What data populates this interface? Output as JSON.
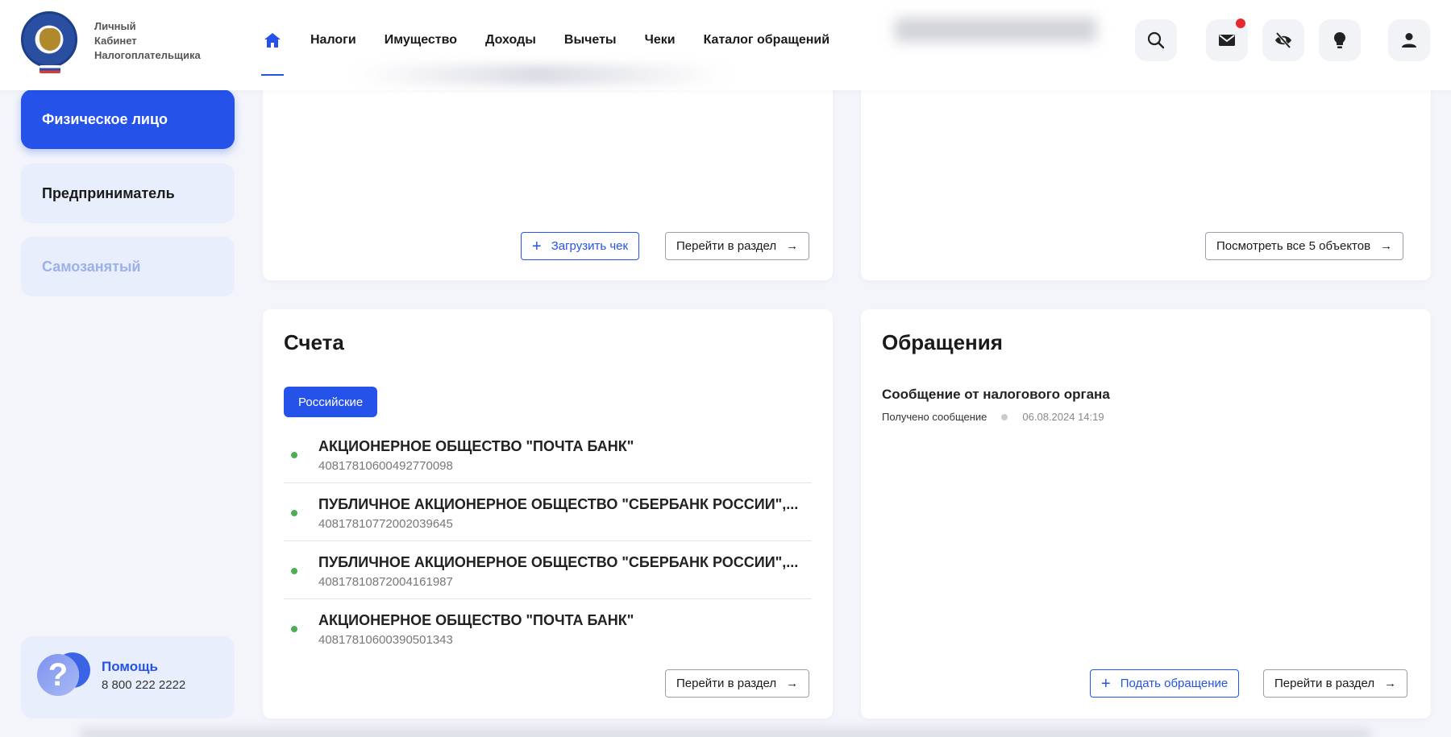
{
  "brand": {
    "line1": "Личный",
    "line2": "Кабинет",
    "line3": "Налогоплательщика"
  },
  "nav": {
    "items": [
      "Налоги",
      "Имущество",
      "Доходы",
      "Вычеты",
      "Чеки",
      "Каталог обращений"
    ]
  },
  "sidebar": {
    "items": [
      {
        "label": "Физическое лицо",
        "state": "active"
      },
      {
        "label": "Предприниматель",
        "state": "normal"
      },
      {
        "label": "Самозанятый",
        "state": "disabled"
      }
    ],
    "help": {
      "title": "Помощь",
      "phone": "8 800 222 2222"
    }
  },
  "cards": {
    "receipts": {
      "upload_label": "Загрузить чек",
      "goto_label": "Перейти в раздел"
    },
    "property": {
      "view_all_label": "Посмотреть все 5 объектов"
    },
    "accounts": {
      "title": "Счета",
      "filter_label": "Российские",
      "items": [
        {
          "name": "АКЦИОНЕРНОЕ ОБЩЕСТВО \"ПОЧТА БАНК\"",
          "number": "40817810600492770098"
        },
        {
          "name": "ПУБЛИЧНОЕ АКЦИОНЕРНОЕ ОБЩЕСТВО \"СБЕРБАНК РОССИИ\",...",
          "number": "40817810772002039645"
        },
        {
          "name": "ПУБЛИЧНОЕ АКЦИОНЕРНОЕ ОБЩЕСТВО \"СБЕРБАНК РОССИИ\",...",
          "number": "40817810872004161987"
        },
        {
          "name": "АКЦИОНЕРНОЕ ОБЩЕСТВО \"ПОЧТА БАНК\"",
          "number": "40817810600390501343"
        }
      ],
      "goto_label": "Перейти в раздел"
    },
    "appeals": {
      "title": "Обращения",
      "message_title": "Сообщение от налогового органа",
      "message_status": "Получено сообщение",
      "message_date": "06.08.2024 14:19",
      "submit_label": "Подать обращение",
      "goto_label": "Перейти в раздел"
    }
  },
  "colors": {
    "accent": "#2552e8",
    "notify": "#e52b2b",
    "status_ok": "#4caf50"
  },
  "icons": [
    "home-icon",
    "search-icon",
    "mail-icon",
    "eye-off-icon",
    "lightbulb-icon",
    "user-icon",
    "question-icon",
    "arrow-right-icon",
    "plus-icon"
  ]
}
